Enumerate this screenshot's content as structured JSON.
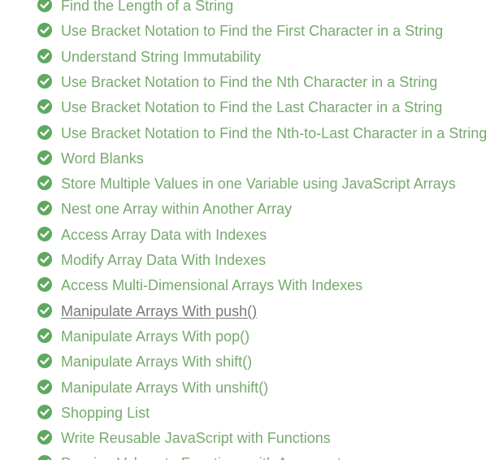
{
  "challenges": [
    {
      "label": "Find the Length of a String",
      "completed": true
    },
    {
      "label": "Use Bracket Notation to Find the First Character in a String",
      "completed": true
    },
    {
      "label": "Understand String Immutability",
      "completed": true
    },
    {
      "label": "Use Bracket Notation to Find the Nth Character in a String",
      "completed": true
    },
    {
      "label": "Use Bracket Notation to Find the Last Character in a String",
      "completed": true
    },
    {
      "label": "Use Bracket Notation to Find the Nth-to-Last Character in a String",
      "completed": true
    },
    {
      "label": "Word Blanks",
      "completed": true
    },
    {
      "label": "Store Multiple Values in one Variable using JavaScript Arrays",
      "completed": true
    },
    {
      "label": "Nest one Array within Another Array",
      "completed": true
    },
    {
      "label": "Access Array Data with Indexes",
      "completed": true
    },
    {
      "label": "Modify Array Data With Indexes",
      "completed": true
    },
    {
      "label": "Access Multi-Dimensional Arrays With Indexes",
      "completed": true
    },
    {
      "label": "Manipulate Arrays With push()",
      "completed": true,
      "hovered": true
    },
    {
      "label": "Manipulate Arrays With pop()",
      "completed": true
    },
    {
      "label": "Manipulate Arrays With shift()",
      "completed": true
    },
    {
      "label": "Manipulate Arrays With unshift()",
      "completed": true
    },
    {
      "label": "Shopping List",
      "completed": true
    },
    {
      "label": "Write Reusable JavaScript with Functions",
      "completed": true
    },
    {
      "label": "Passing Values to Functions with Arguments",
      "completed": true
    }
  ],
  "colors": {
    "check": "#5fa860",
    "link": "#77aa6e",
    "hover_link": "#7a7a7a"
  },
  "icons": {
    "check": "check-circle-icon"
  }
}
